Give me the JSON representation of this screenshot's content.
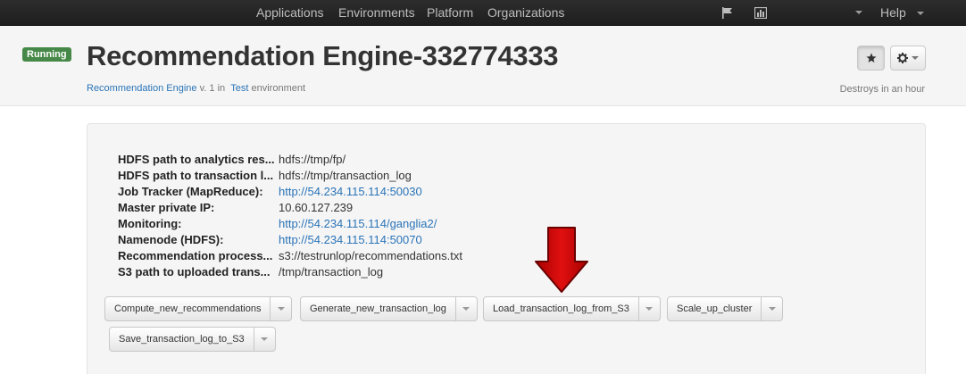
{
  "topnav": {
    "links": [
      "Applications",
      "Environments",
      "Platform",
      "Organizations"
    ],
    "help_label": "Help",
    "icons": [
      "flag-icon",
      "chart-icon"
    ]
  },
  "header": {
    "status": "Running",
    "title": "Recommendation Engine-332774333",
    "app_link": "Recommendation Engine",
    "version_text": "v. 1 in",
    "env_link": "Test",
    "env_suffix": "environment",
    "destroys": "Destroys in an hour"
  },
  "properties": [
    {
      "label": "HDFS path to analytics res...",
      "value": "hdfs://tmp/fp/",
      "is_link": false
    },
    {
      "label": "HDFS path to transaction l...",
      "value": "hdfs://tmp/transaction_log",
      "is_link": false
    },
    {
      "label": "Job Tracker (MapReduce):",
      "value": "http://54.234.115.114:50030",
      "is_link": true
    },
    {
      "label": "Master private IP:",
      "value": "10.60.127.239",
      "is_link": false
    },
    {
      "label": "Monitoring:",
      "value": "http://54.234.115.114/ganglia2/",
      "is_link": true
    },
    {
      "label": "Namenode (HDFS):",
      "value": "http://54.234.115.114:50070",
      "is_link": true
    },
    {
      "label": "Recommendation process...",
      "value": "s3://testrunlop/recommendations.txt",
      "is_link": false
    },
    {
      "label": "S3 path to uploaded trans...",
      "value": "/tmp/transaction_log",
      "is_link": false
    }
  ],
  "actions": [
    "Compute_new_recommendations",
    "Generate_new_transaction_log",
    "Load_transaction_log_from_S3",
    "Scale_up_cluster",
    "Save_transaction_log_to_S3"
  ],
  "colors": {
    "running_badge": "#468847",
    "link": "#2a74b8",
    "arrow": "#cc0000"
  }
}
